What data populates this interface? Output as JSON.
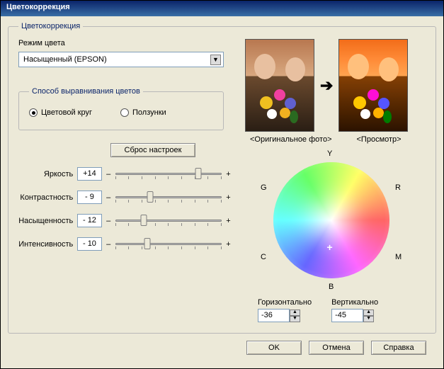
{
  "title": "Цветокоррекция",
  "groupTitle": "Цветокоррекция",
  "modeLabel": "Режим цвета",
  "modeValue": "Насыщенный (EPSON)",
  "balanceTitle": "Способ выравнивания цветов",
  "radio1": "Цветовой круг",
  "radio2": "Ползунки",
  "resetLabel": "Сброс настроек",
  "sliders": {
    "brightness": {
      "label": "Яркость",
      "value": "+14",
      "pos": 78
    },
    "contrast": {
      "label": "Контрастность",
      "value": "- 9",
      "pos": 33
    },
    "saturation": {
      "label": "Насыщенность",
      "value": "- 12",
      "pos": 27
    },
    "intensity": {
      "label": "Интенсивность",
      "value": "- 10",
      "pos": 30
    }
  },
  "origLabel": "<Оригинальное фото>",
  "previewLabel": "<Просмотр>",
  "wheel": {
    "Y": "Y",
    "G": "G",
    "R": "R",
    "C": "C",
    "M": "M",
    "B": "B"
  },
  "hLabel": "Горизонтально",
  "vLabel": "Вертикально",
  "hValue": "-36",
  "vValue": "-45",
  "ok": "OK",
  "cancel": "Отмена",
  "help": "Справка",
  "minus": "–",
  "plus": "+"
}
